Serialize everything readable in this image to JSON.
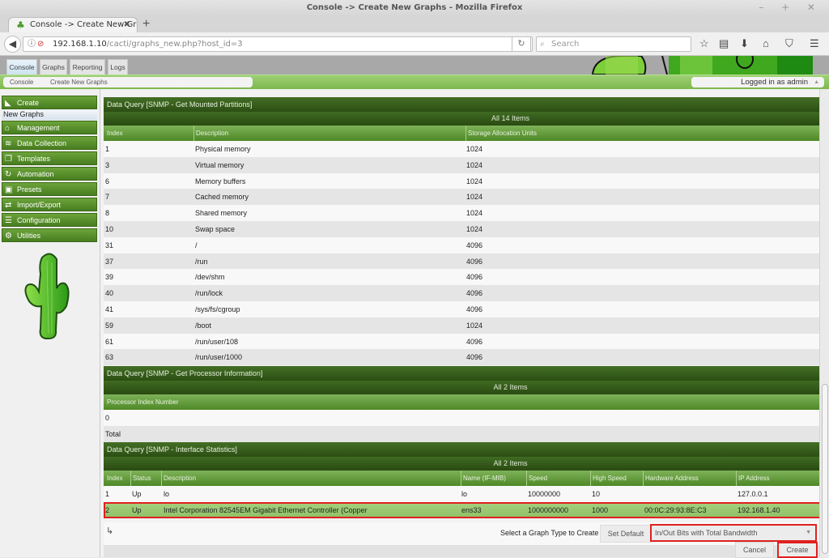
{
  "window": {
    "title": "Console -> Create New Graphs - Mozilla Firefox",
    "controls": "– + ✕"
  },
  "browser": {
    "tab_title": "Console -> Create New Gra",
    "url_host": "192.168.1.10",
    "url_path": "/cacti/graphs_new.php?host_id=3",
    "search_placeholder": "Search",
    "icons": [
      "star-icon",
      "reading-list-icon",
      "download-icon",
      "home-icon",
      "pocket-icon",
      "menu-icon"
    ]
  },
  "app_tabs": [
    {
      "label": "Console",
      "active": true
    },
    {
      "label": "Graphs",
      "active": false
    },
    {
      "label": "Reporting",
      "active": false
    },
    {
      "label": "Logs",
      "active": false
    }
  ],
  "breadcrumb": [
    "Console",
    "Create New Graphs"
  ],
  "user": {
    "logged_in": "Logged in as admin"
  },
  "sidebar": {
    "items": [
      {
        "label": "Create",
        "icon": "chart-area-icon"
      },
      {
        "label": "New Graphs",
        "sub": true
      },
      {
        "label": "Management",
        "icon": "home-icon"
      },
      {
        "label": "Data Collection",
        "icon": "database-icon"
      },
      {
        "label": "Templates",
        "icon": "copy-icon"
      },
      {
        "label": "Automation",
        "icon": "refresh-icon"
      },
      {
        "label": "Presets",
        "icon": "archive-icon"
      },
      {
        "label": "Import/Export",
        "icon": "exchange-icon"
      },
      {
        "label": "Configuration",
        "icon": "sliders-icon"
      },
      {
        "label": "Utilities",
        "icon": "cogs-icon"
      }
    ]
  },
  "queries": [
    {
      "title": "Data Query [SNMP - Get Mounted Partitions]",
      "count": "All 14 Items",
      "columns": [
        "Index",
        "Description",
        "Storage Allocation Units"
      ],
      "rows": [
        [
          "1",
          "Physical memory",
          "1024"
        ],
        [
          "3",
          "Virtual memory",
          "1024"
        ],
        [
          "6",
          "Memory buffers",
          "1024"
        ],
        [
          "7",
          "Cached memory",
          "1024"
        ],
        [
          "8",
          "Shared memory",
          "1024"
        ],
        [
          "10",
          "Swap space",
          "1024"
        ],
        [
          "31",
          "/",
          "4096"
        ],
        [
          "37",
          "/run",
          "4096"
        ],
        [
          "39",
          "/dev/shm",
          "4096"
        ],
        [
          "40",
          "/run/lock",
          "4096"
        ],
        [
          "41",
          "/sys/fs/cgroup",
          "4096"
        ],
        [
          "59",
          "/boot",
          "1024"
        ],
        [
          "61",
          "/run/user/108",
          "4096"
        ],
        [
          "63",
          "/run/user/1000",
          "4096"
        ]
      ]
    },
    {
      "title": "Data Query [SNMP - Get Processor Information]",
      "count": "All 2 Items",
      "columns": [
        "Processor Index Number"
      ],
      "rows": [
        [
          "0"
        ],
        [
          "Total"
        ]
      ]
    },
    {
      "title": "Data Query [SNMP - Interface Statistics]",
      "count": "All 2 Items",
      "columns": [
        "Index",
        "Status",
        "Description",
        "Name (IF-MIB)",
        "Speed",
        "High Speed",
        "Hardware Address",
        "IP Address"
      ],
      "rows": [
        [
          "1",
          "Up",
          "lo",
          "lo",
          "10000000",
          "10",
          "",
          "127.0.0.1"
        ],
        [
          "2",
          "Up",
          "Intel Corporation 82545EM Gigabit Ethernet Controller (Copper",
          "ens33",
          "1000000000",
          "1000",
          "00:0C:29:93:8E:C3",
          "192.168.1.40"
        ]
      ],
      "selected_row": 1
    }
  ],
  "actions": {
    "graph_type_label": "Select a Graph Type to Create",
    "set_default": "Set Default",
    "graph_type_value": "In/Out Bits with Total Bandwidth",
    "cancel": "Cancel",
    "create": "Create"
  }
}
